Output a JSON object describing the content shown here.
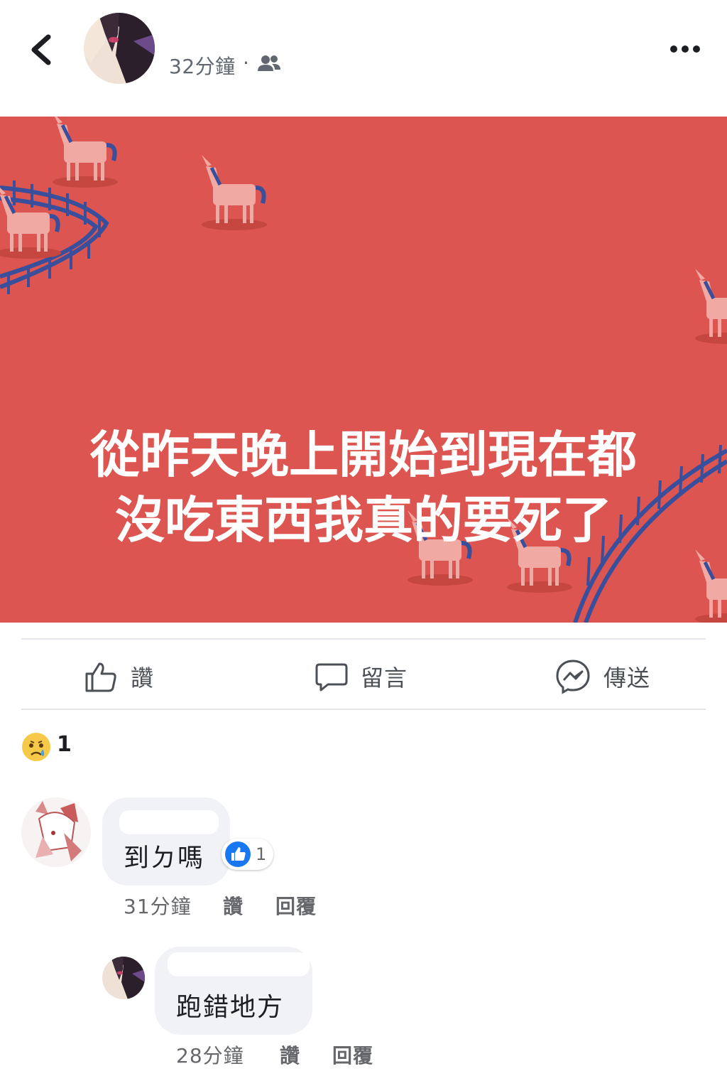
{
  "header": {
    "post_time": "32分鐘",
    "separator": "·",
    "audience_icon": "friends-icon",
    "more_icon": "more-horizontal-icon",
    "back_icon": "chevron-left-icon"
  },
  "post": {
    "background_color": "#dd5550",
    "text_line_1": "從昨天晚上開始到現在都",
    "text_line_2": "沒吃東西我真的要死了"
  },
  "actions": {
    "like_label": "讚",
    "comment_label": "留言",
    "send_label": "傳送"
  },
  "reactions": {
    "emoji": "crying-face",
    "count": "1"
  },
  "comments": [
    {
      "text": "到ㄉ嗎",
      "likes": "1",
      "time": "31分鐘",
      "like_label": "讚",
      "reply_label": "回覆"
    },
    {
      "text": "跑錯地方",
      "time": "28分鐘",
      "like_label": "讚",
      "reply_label": "回覆"
    }
  ],
  "colors": {
    "accent_blue": "#1877f2",
    "meta_gray": "#65676b",
    "fence_blue": "#3a4f9c",
    "unicorn_pink": "#f1a9a4"
  }
}
